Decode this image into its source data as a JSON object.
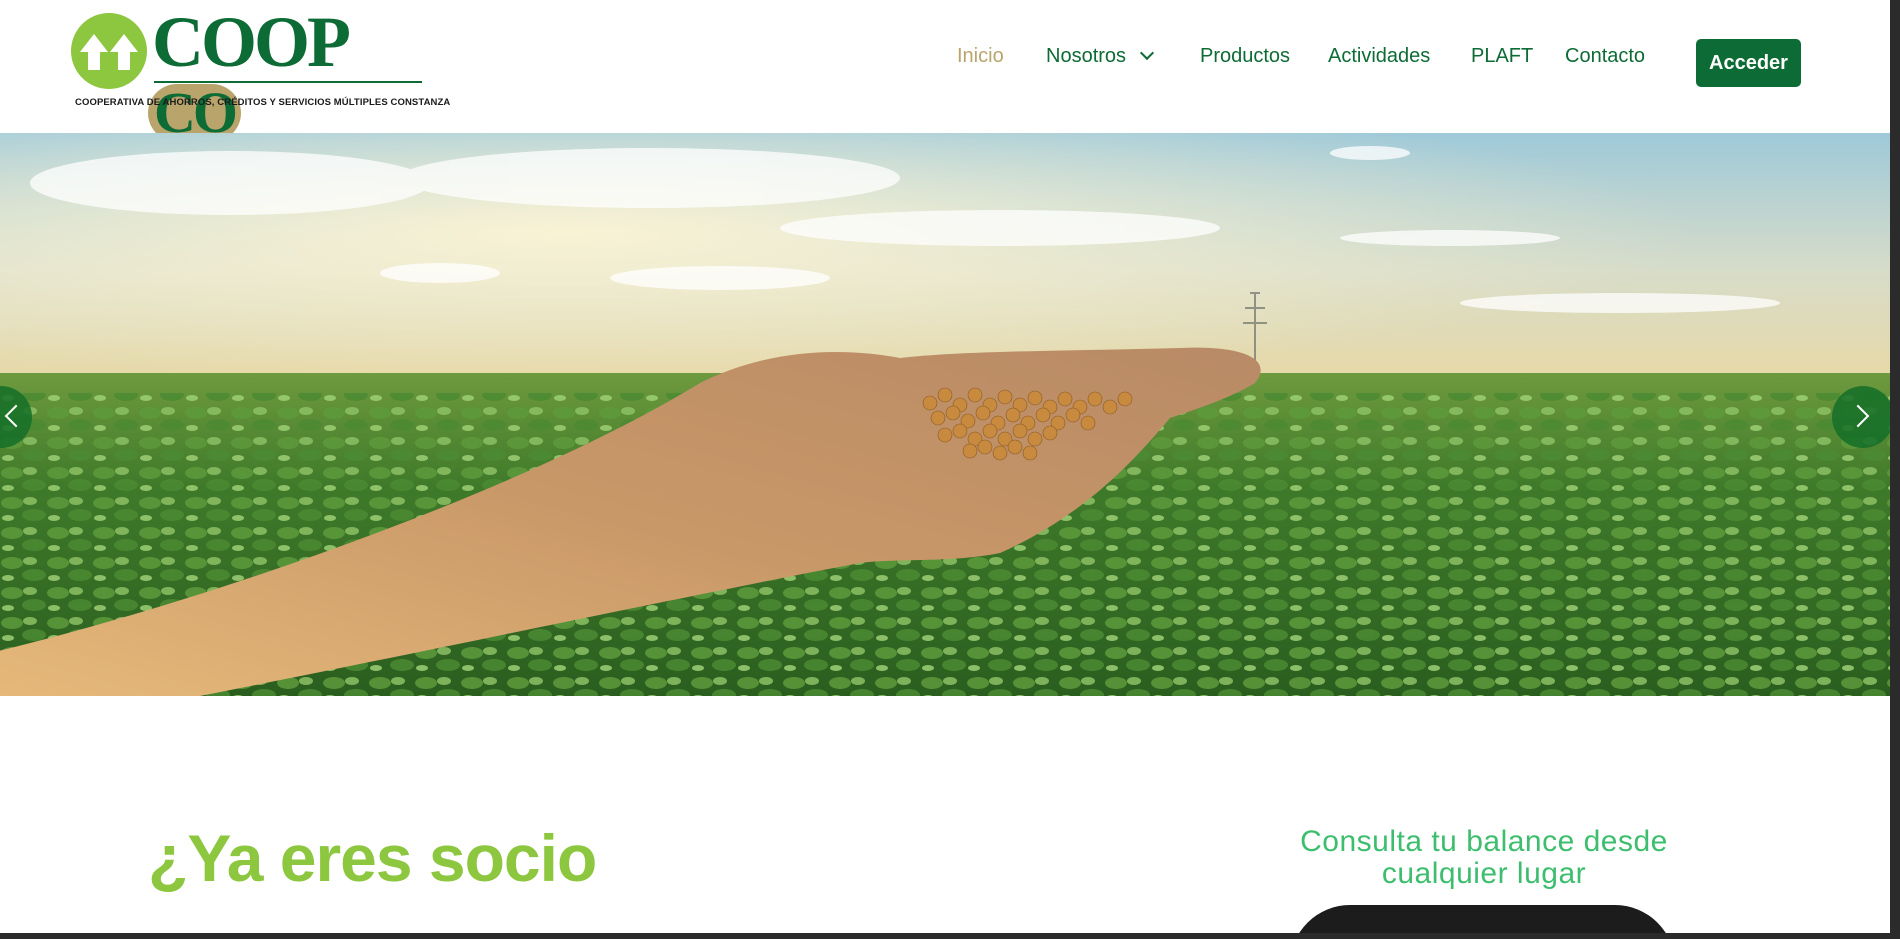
{
  "header": {
    "logo": {
      "wordmark": "COOPCO",
      "wordmark_main": "COOP",
      "wordmark_accent": "CO",
      "tagline": "COOPERATIVA DE AHORROS, CRÉDITOS Y SERVICIOS MÚLTIPLES CONSTANZA"
    },
    "nav": [
      {
        "label": "Inicio",
        "active": true
      },
      {
        "label": "Nosotros",
        "dropdown": true
      },
      {
        "label": "Productos"
      },
      {
        "label": "Actividades"
      },
      {
        "label": "PLAFT"
      },
      {
        "label": "Contacto"
      }
    ],
    "cta_label": "Acceder"
  },
  "hero": {
    "icons": {
      "prev": "chevron-left-icon",
      "next": "chevron-right-icon"
    }
  },
  "content": {
    "heading": "¿Ya eres socio",
    "balance_text": "Consulta tu balance desde cualquier lugar"
  },
  "colors": {
    "brand_green": "#0d6b35",
    "gold": "#b9a46b",
    "lime": "#8dc63f",
    "mint": "#3dbe6e"
  }
}
